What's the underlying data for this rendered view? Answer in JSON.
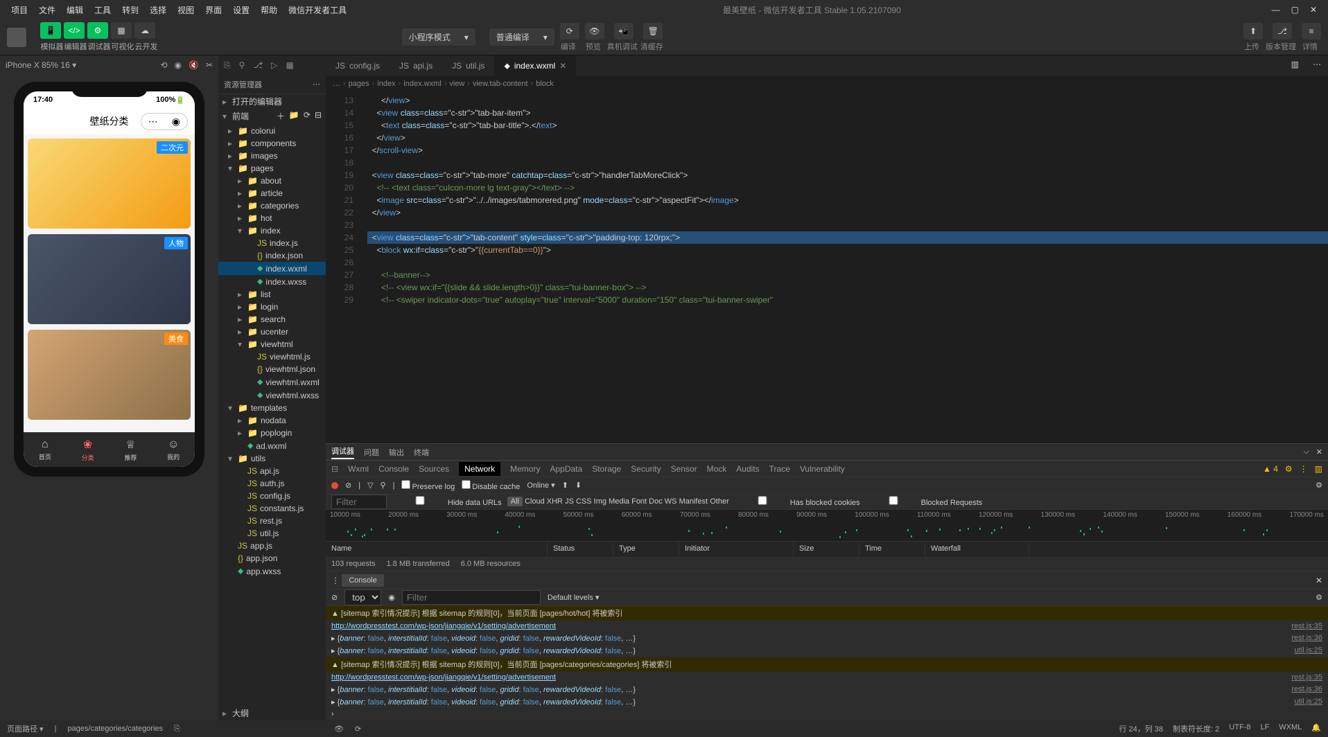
{
  "menubar": {
    "items": [
      "项目",
      "文件",
      "编辑",
      "工具",
      "转到",
      "选择",
      "视图",
      "界面",
      "设置",
      "帮助",
      "微信开发者工具"
    ],
    "title": "最美壁纸 - 微信开发者工具 Stable 1.05.2107090"
  },
  "toolbar": {
    "modes": [
      "模拟器",
      "编辑器",
      "调试器",
      "可视化",
      "云开发"
    ],
    "select1": "小程序模式",
    "select2": "普通编译",
    "right_labels": [
      "编译",
      "预览",
      "真机调试",
      "清缓存"
    ],
    "far_right": [
      "上传",
      "版本管理",
      "详情"
    ]
  },
  "simulator": {
    "device": "iPhone X 85% 16 ▾",
    "phone_time": "17:40",
    "phone_battery": "100%",
    "page_title": "壁纸分类",
    "tags": [
      "二次元",
      "人物",
      "美食"
    ],
    "tabbar": [
      {
        "icon": "⌂",
        "label": "首页"
      },
      {
        "icon": "❀",
        "label": "分类"
      },
      {
        "icon": "♕",
        "label": "推荐"
      },
      {
        "icon": "☺",
        "label": "我的"
      }
    ]
  },
  "explorer": {
    "title": "资源管理器",
    "sections": [
      "打开的编辑器",
      "前端"
    ],
    "outline": "大纲",
    "tree": [
      {
        "l": 1,
        "t": "folder",
        "n": "colorui"
      },
      {
        "l": 1,
        "t": "folder",
        "n": "components"
      },
      {
        "l": 1,
        "t": "folder",
        "n": "images"
      },
      {
        "l": 1,
        "t": "folder",
        "n": "pages",
        "open": true
      },
      {
        "l": 2,
        "t": "folder",
        "n": "about"
      },
      {
        "l": 2,
        "t": "folder",
        "n": "article"
      },
      {
        "l": 2,
        "t": "folder",
        "n": "categories"
      },
      {
        "l": 2,
        "t": "folder",
        "n": "hot"
      },
      {
        "l": 2,
        "t": "folder",
        "n": "index",
        "open": true
      },
      {
        "l": 3,
        "t": "js",
        "n": "index.js"
      },
      {
        "l": 3,
        "t": "json",
        "n": "index.json"
      },
      {
        "l": 3,
        "t": "wxml",
        "n": "index.wxml",
        "sel": true
      },
      {
        "l": 3,
        "t": "wxss",
        "n": "index.wxss"
      },
      {
        "l": 2,
        "t": "folder",
        "n": "list"
      },
      {
        "l": 2,
        "t": "folder",
        "n": "login"
      },
      {
        "l": 2,
        "t": "folder",
        "n": "search"
      },
      {
        "l": 2,
        "t": "folder",
        "n": "ucenter"
      },
      {
        "l": 2,
        "t": "folder",
        "n": "viewhtml",
        "open": true
      },
      {
        "l": 3,
        "t": "js",
        "n": "viewhtml.js"
      },
      {
        "l": 3,
        "t": "json",
        "n": "viewhtml.json"
      },
      {
        "l": 3,
        "t": "wxml",
        "n": "viewhtml.wxml"
      },
      {
        "l": 3,
        "t": "wxss",
        "n": "viewhtml.wxss"
      },
      {
        "l": 1,
        "t": "folder",
        "n": "templates",
        "open": true
      },
      {
        "l": 2,
        "t": "folder",
        "n": "nodata"
      },
      {
        "l": 2,
        "t": "folder",
        "n": "poplogin"
      },
      {
        "l": 2,
        "t": "wxml",
        "n": "ad.wxml"
      },
      {
        "l": 1,
        "t": "folder",
        "n": "utils",
        "open": true
      },
      {
        "l": 2,
        "t": "js",
        "n": "api.js"
      },
      {
        "l": 2,
        "t": "js",
        "n": "auth.js"
      },
      {
        "l": 2,
        "t": "js",
        "n": "config.js"
      },
      {
        "l": 2,
        "t": "js",
        "n": "constants.js"
      },
      {
        "l": 2,
        "t": "js",
        "n": "rest.js"
      },
      {
        "l": 2,
        "t": "js",
        "n": "util.js"
      },
      {
        "l": 1,
        "t": "js",
        "n": "app.js"
      },
      {
        "l": 1,
        "t": "json",
        "n": "app.json"
      },
      {
        "l": 1,
        "t": "wxss",
        "n": "app.wxss"
      }
    ]
  },
  "tabs": [
    {
      "name": "config.js",
      "icon": "js"
    },
    {
      "name": "api.js",
      "icon": "js"
    },
    {
      "name": "util.js",
      "icon": "js"
    },
    {
      "name": "index.wxml",
      "icon": "wxml",
      "active": true
    }
  ],
  "breadcrumb": [
    "…",
    "pages",
    "index",
    "index.wxml",
    "view",
    "view.tab-content",
    "block"
  ],
  "code_start_line": 13,
  "code_lines": [
    "      </view>",
    "    <view class=\"tab-bar-item\">",
    "      <text class=\"tab-bar-title\">.</text>",
    "    </view>",
    "  </scroll-view>",
    "",
    "  <view class=\"tab-more\" catchtap=\"handlerTabMoreClick\">",
    "    <!-- <text class=\"cuIcon-more lg text-gray\"></text> -->",
    "    <image src=\"../../images/tabmorered.png\" mode=\"aspectFit\"></image>",
    "  </view>",
    "",
    "  <view class=\"tab-content\" style=\"padding-top: 120rpx;\">",
    "    <block wx:if=\"{{currentTab==0}}\">",
    "",
    "      <!--banner-->",
    "      <!-- <view wx:if=\"{{slide && slide.length>0}}\" class=\"tui-banner-box\"> -->",
    "      <!-- <swiper indicator-dots=\"true\" autoplay=\"true\" interval=\"5000\" duration=\"150\" class=\"tui-banner-swiper\""
  ],
  "devtools": {
    "top_tabs": [
      "调试器",
      "问题",
      "输出",
      "终端"
    ],
    "panels": [
      "Wxml",
      "Console",
      "Sources",
      "Network",
      "Memory",
      "AppData",
      "Storage",
      "Security",
      "Sensor",
      "Mock",
      "Audits",
      "Trace",
      "Vulnerability"
    ],
    "active_panel": "Network",
    "warn_count": "4",
    "net_toolbar": {
      "preserve": "Preserve log",
      "disable": "Disable cache",
      "online": "Online"
    },
    "net_filter": {
      "placeholder": "Filter",
      "hide_data": "Hide data URLs",
      "types": [
        "All",
        "Cloud",
        "XHR",
        "JS",
        "CSS",
        "Img",
        "Media",
        "Font",
        "Doc",
        "WS",
        "Manifest",
        "Other"
      ],
      "blocked_cookies": "Has blocked cookies",
      "blocked_req": "Blocked Requests"
    },
    "waterfall_ticks": [
      "10000 ms",
      "20000 ms",
      "30000 ms",
      "40000 ms",
      "50000 ms",
      "60000 ms",
      "70000 ms",
      "80000 ms",
      "90000 ms",
      "100000 ms",
      "110000 ms",
      "120000 ms",
      "130000 ms",
      "140000 ms",
      "150000 ms",
      "160000 ms",
      "170000 ms"
    ],
    "net_cols": [
      "Name",
      "Status",
      "Type",
      "Initiator",
      "Size",
      "Time",
      "Waterfall"
    ],
    "summary": [
      "103 requests",
      "1.8 MB transferred",
      "6.0 MB resources"
    ],
    "console_tab": "Console",
    "console_ctx": "top",
    "console_filter": "Filter",
    "console_levels": "Default levels ▾",
    "logs": [
      {
        "type": "warn",
        "msg": "[sitemap 索引情况提示] 根据 sitemap 的规则[0]，当前页面 [pages/hot/hot] 将被索引",
        "src": ""
      },
      {
        "type": "link",
        "msg": "http://wordpresstest.com/wp-json/jiangqie/v1/setting/advertisement",
        "src": "rest.js:35"
      },
      {
        "type": "obj",
        "msg": "▸ {banner: false, interstitialId: false, videoid: false, gridid: false, rewardedVideoId: false, …}",
        "src": "rest.js:36"
      },
      {
        "type": "obj",
        "msg": "▸ {banner: false, interstitialId: false, videoid: false, gridid: false, rewardedVideoId: false, …}",
        "src": "util.js:25"
      },
      {
        "type": "warn",
        "msg": "[sitemap 索引情况提示] 根据 sitemap 的规则[0]，当前页面 [pages/categories/categories] 将被索引",
        "src": ""
      },
      {
        "type": "link",
        "msg": "http://wordpresstest.com/wp-json/jiangqie/v1/setting/advertisement",
        "src": "rest.js:35"
      },
      {
        "type": "obj",
        "msg": "▸ {banner: false, interstitialId: false, videoid: false, gridid: false, rewardedVideoId: false, …}",
        "src": "rest.js:36"
      },
      {
        "type": "obj",
        "msg": "▸ {banner: false, interstitialId: false, videoid: false, gridid: false, rewardedVideoId: false, …}",
        "src": "util.js:25"
      }
    ]
  },
  "statusbar": {
    "path_label": "页面路径 ▾",
    "path": "pages/categories/categories",
    "cursor": "行 24，列 38",
    "tab": "制表符长度: 2",
    "enc": "UTF-8",
    "eol": "LF",
    "lang": "WXML"
  }
}
